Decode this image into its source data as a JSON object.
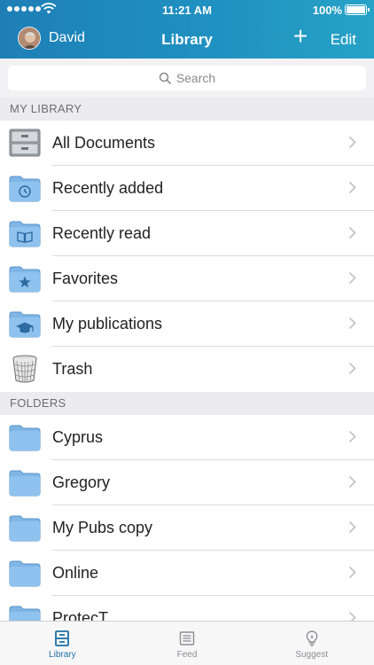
{
  "status_bar": {
    "time": "11:21 AM",
    "battery": "100%",
    "battery_level": 1.0
  },
  "nav": {
    "user_name": "David",
    "title": "Library",
    "add_label": "+",
    "edit_label": "Edit"
  },
  "search": {
    "placeholder": "Search"
  },
  "my_library": {
    "header": "MY LIBRARY",
    "items": [
      {
        "label": "All Documents",
        "icon": "file-cabinet-icon"
      },
      {
        "label": "Recently added",
        "icon": "folder-clock-icon"
      },
      {
        "label": "Recently read",
        "icon": "folder-book-icon"
      },
      {
        "label": "Favorites",
        "icon": "folder-star-icon"
      },
      {
        "label": "My publications",
        "icon": "folder-graduation-cap-icon"
      },
      {
        "label": "Trash",
        "icon": "trash-icon"
      }
    ]
  },
  "folders": {
    "header": "FOLDERS",
    "items": [
      {
        "label": "Cyprus",
        "icon": "folder-icon"
      },
      {
        "label": "Gregory",
        "icon": "folder-icon"
      },
      {
        "label": "My Pubs copy",
        "icon": "folder-icon"
      },
      {
        "label": "Online",
        "icon": "folder-icon"
      },
      {
        "label": "ProtecT",
        "icon": "folder-icon"
      }
    ]
  },
  "tabbar": {
    "tabs": [
      {
        "label": "Library",
        "icon": "library-icon",
        "active": true
      },
      {
        "label": "Feed",
        "icon": "feed-icon",
        "active": false
      },
      {
        "label": "Suggest",
        "icon": "lightbulb-icon",
        "active": false
      }
    ]
  },
  "colors": {
    "nav_gradient_start": "#1e7fb6",
    "nav_gradient_end": "#26a2c7",
    "active_tab": "#1f6fa6",
    "folder_blue": "#7fb6e6"
  }
}
